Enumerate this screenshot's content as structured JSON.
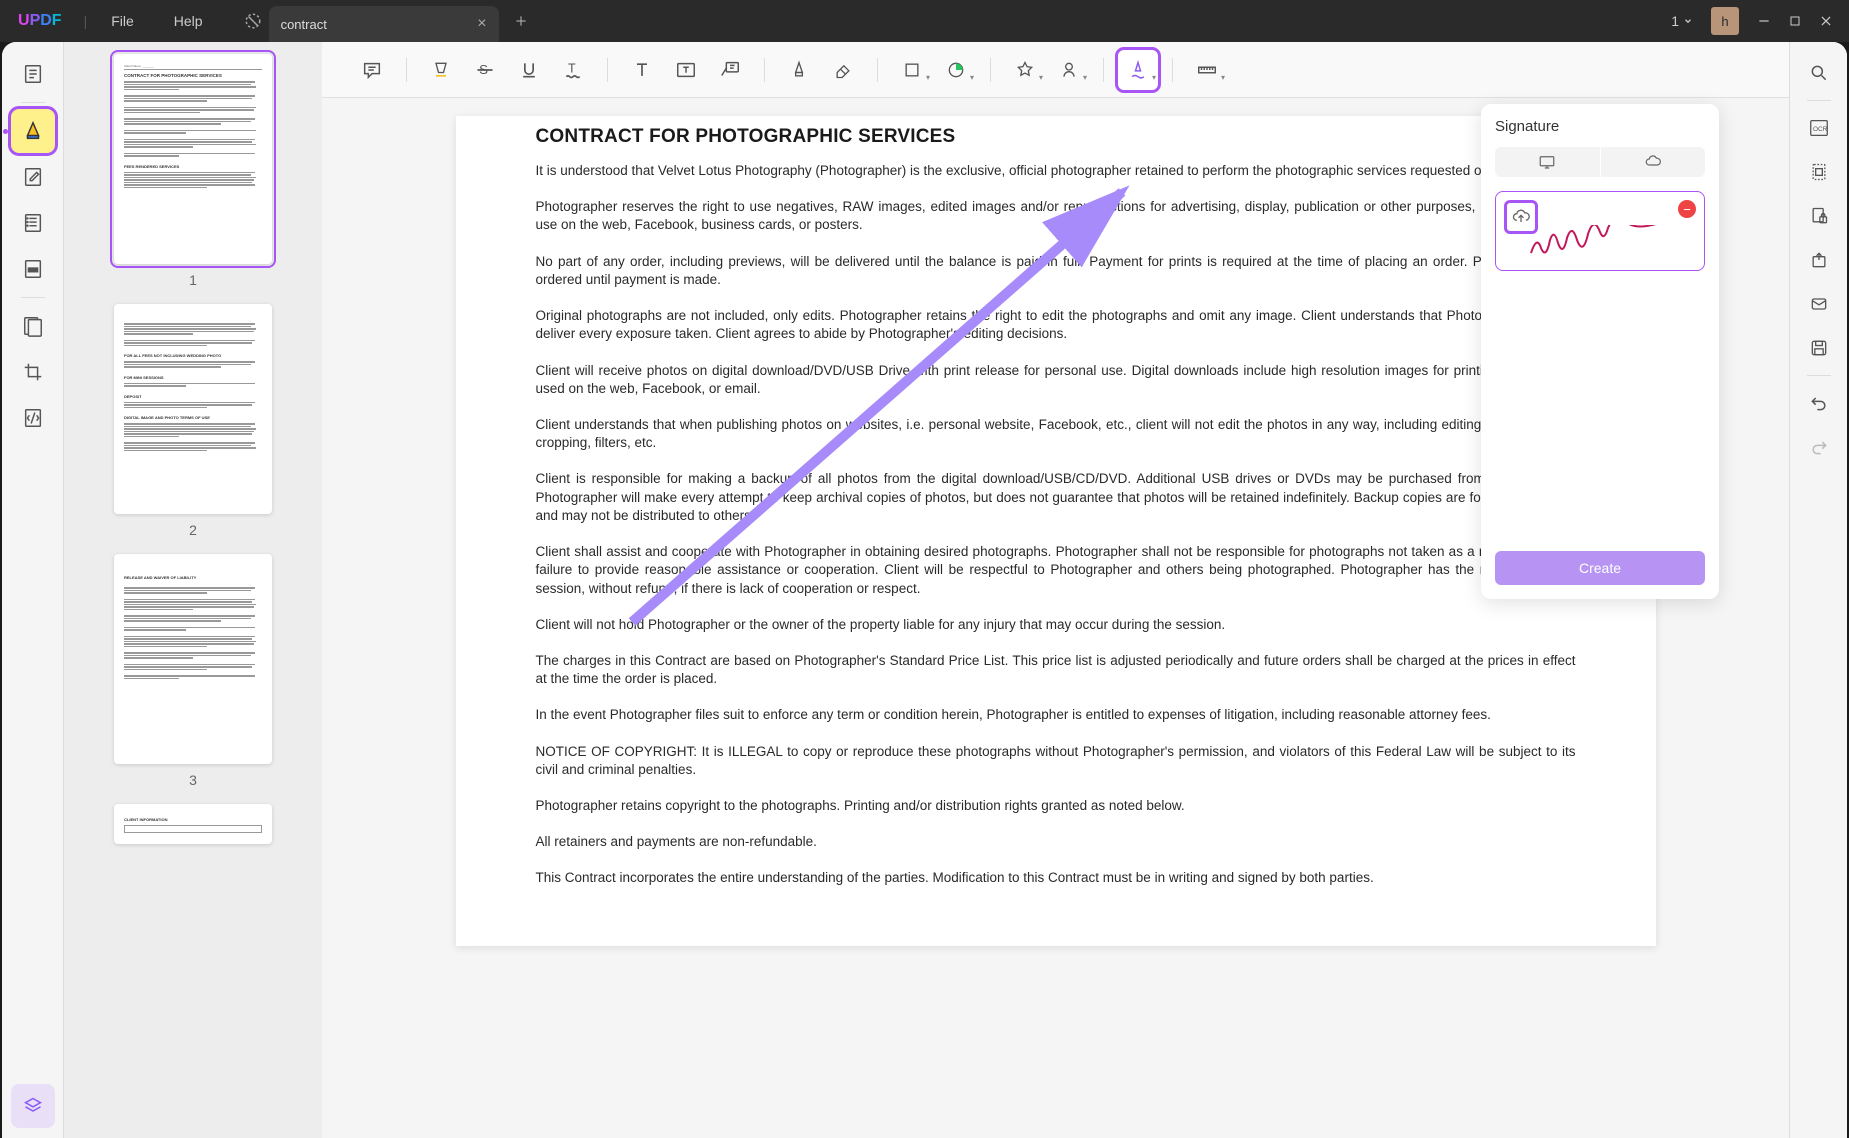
{
  "app": {
    "logo": "UPDF"
  },
  "menu": {
    "file": "File",
    "help": "Help"
  },
  "tab": {
    "label": "contract"
  },
  "titlebar": {
    "page_num": "1",
    "avatar_letter": "h"
  },
  "thumbnails": {
    "p1": "1",
    "p2": "2",
    "p3": "3"
  },
  "document": {
    "title": "CONTRACT FOR PHOTOGRAPHIC SERVICES",
    "p1": "It is understood that Velvet Lotus Photography (Photographer) is the exclusive, official photographer retained to perform the photographic services requested on this contract.",
    "p2": "Photographer reserves the right to use negatives, RAW images, edited images and/or reproductions for advertising, display, publication or other purposes, not restricted to use on the web, Facebook, business cards, or posters.",
    "p3": "No part of any order, including previews, will be delivered until the balance is paid in full. Payment for prints is required at the time of placing an order. Prints will not be ordered until payment is made.",
    "p4": "Original photographs are not included, only edits. Photographer retains the right to edit the photographs and omit any image. Client understands that Photographer will not deliver every exposure taken. Client agrees to abide by Photographer's editing decisions.",
    "p5": "Client will receive photos on digital download/DVD/USB Drive with print release for personal use. Digital downloads include high resolution images for printing and may be used on the web, Facebook, or email.",
    "p6": "Client understands that when publishing photos on websites, i.e. personal website, Facebook, etc., client will not edit the photos in any way, including editing the watermark, cropping, filters, etc.",
    "p7": "Client is responsible for making a backup of all photos from the digital download/USB/CD/DVD. Additional USB drives or DVDs may be purchased from Photographer. Photographer will make every attempt to keep archival copies of photos, but does not guarantee that photos will be retained indefinitely. Backup copies are for client use only and may not be distributed to others.",
    "p8": "Client shall assist and cooperate with Photographer in obtaining desired photographs. Photographer shall not be responsible for photographs not taken as a result of Client's failure to provide reasonable assistance or cooperation. Client will be respectful to Photographer and others being photographed. Photographer has the right to end the session, without refund, if there is lack of cooperation or respect.",
    "p9": "Client will not hold Photographer or the owner of the property liable for any injury that may occur during the session.",
    "p10": "The charges in this Contract are based on Photographer's Standard Price List. This price list is adjusted periodically and future orders shall be charged at the prices in effect at the time the order is placed.",
    "p11": "In the event Photographer files suit to enforce any term or condition herein, Photographer is entitled to expenses of litigation, including reasonable attorney fees.",
    "p12": "NOTICE OF COPYRIGHT: It is ILLEGAL to copy or reproduce these photographs without Photographer's permission, and violators of this Federal Law will be subject to its civil and criminal penalties.",
    "p13": "Photographer retains copyright to the photographs. Printing and/or distribution rights granted as noted below.",
    "p14": "All retainers and payments are non-refundable.",
    "p15": "This Contract incorporates the entire understanding of the parties. Modification to this Contract must be in writing and signed by both parties."
  },
  "signature_panel": {
    "title": "Signature",
    "create_label": "Create"
  }
}
